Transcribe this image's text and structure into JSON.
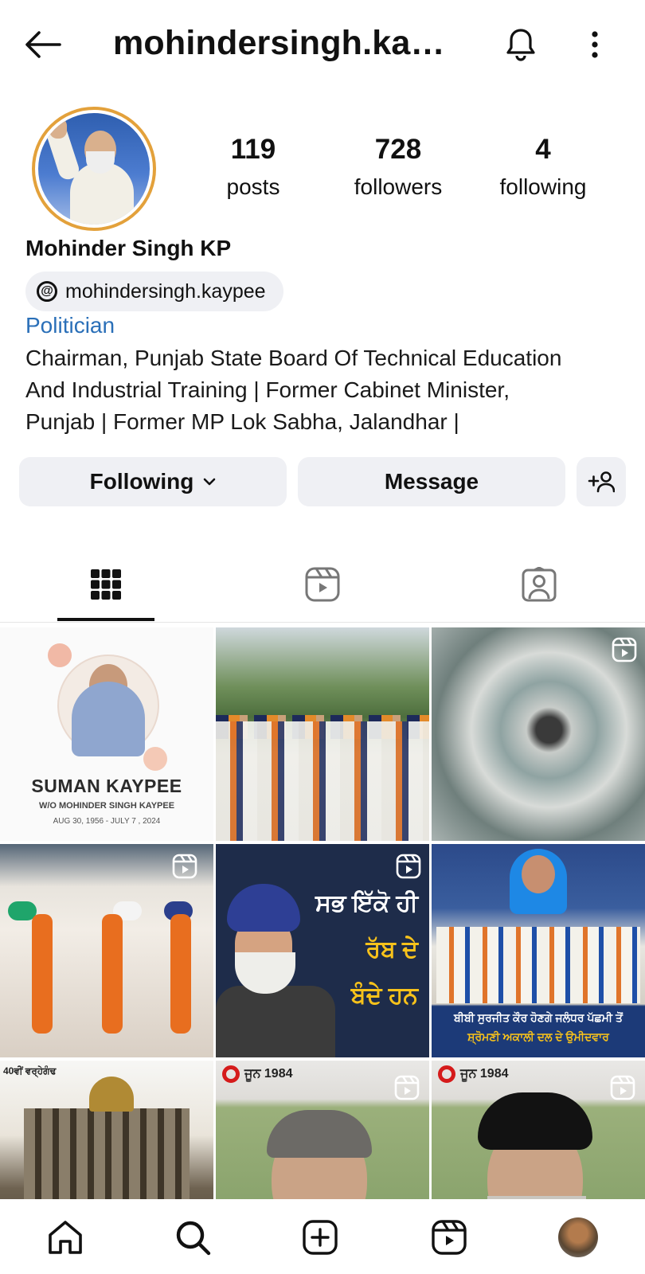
{
  "header": {
    "title": "mohindersingh.kayp...",
    "back_icon": "arrow-left-icon",
    "bell_icon": "bell-icon",
    "more_icon": "more-vertical-icon"
  },
  "profile": {
    "full_name": "Mohinder Singh KP",
    "threads_handle": "mohindersingh.kaypee",
    "threads_logo_glyph": "@",
    "category": "Politician",
    "bio_lines": [
      "Chairman, Punjab State Board Of Technical Education",
      "And Industrial Training  |  Former Cabinet Minister,",
      "Punjab  |  Former MP Lok Sabha, Jalandhar  |"
    ]
  },
  "stats": {
    "posts_count": "119",
    "posts_label": "posts",
    "followers_count": "728",
    "followers_label": "followers",
    "following_count": "4",
    "following_label": "following"
  },
  "actions": {
    "following_label": "Following",
    "message_label": "Message"
  },
  "tabs": [
    {
      "name": "posts-grid",
      "icon": "grid-icon",
      "active": true
    },
    {
      "name": "reels",
      "icon": "reels-icon",
      "active": false
    },
    {
      "name": "tagged",
      "icon": "tagged-icon",
      "active": false
    }
  ],
  "grid_posts": {
    "post1": {
      "name": "SUMAN KAYPEE",
      "relation": "W/O MOHINDER SINGH KAYPEE",
      "dates": "AUG 30, 1956 - JULY 7 , 2024"
    },
    "post5": {
      "line1": "ਸਭ ਇੱਕੋ ਹੀ",
      "line2": "ਰੱਬ ਦੇ",
      "line3": "ਬੰਦੇ ਹਨ"
    },
    "post6": {
      "caption1": "ਬੀਬੀ ਸੁਰਜੀਤ ਕੌਰ ਹੋਣਗੇ ਜਲੰਧਰ ਪੱਛਮੀ ਤੋਂ",
      "caption2": "ਸ਼੍ਰੋਮਣੀ ਅਕਾਲੀ ਦਲ ਦੇ ਉਮੀਦਵਾਰ"
    },
    "post7": {
      "tag": "40ਵੀਂ ਵਰ੍ਹੇਗੰਢ"
    },
    "post8": {
      "label": "ਜੂਨ 1984"
    },
    "post9": {
      "label": "ਜੂਨ 1984"
    }
  },
  "bottom_nav": [
    "home-icon",
    "search-icon",
    "create-icon",
    "reels-icon",
    "profile-avatar"
  ],
  "colors": {
    "category_link": "#2a6fb8",
    "avatar_ring": "#e3a13b",
    "button_bg": "#eff0f4"
  }
}
